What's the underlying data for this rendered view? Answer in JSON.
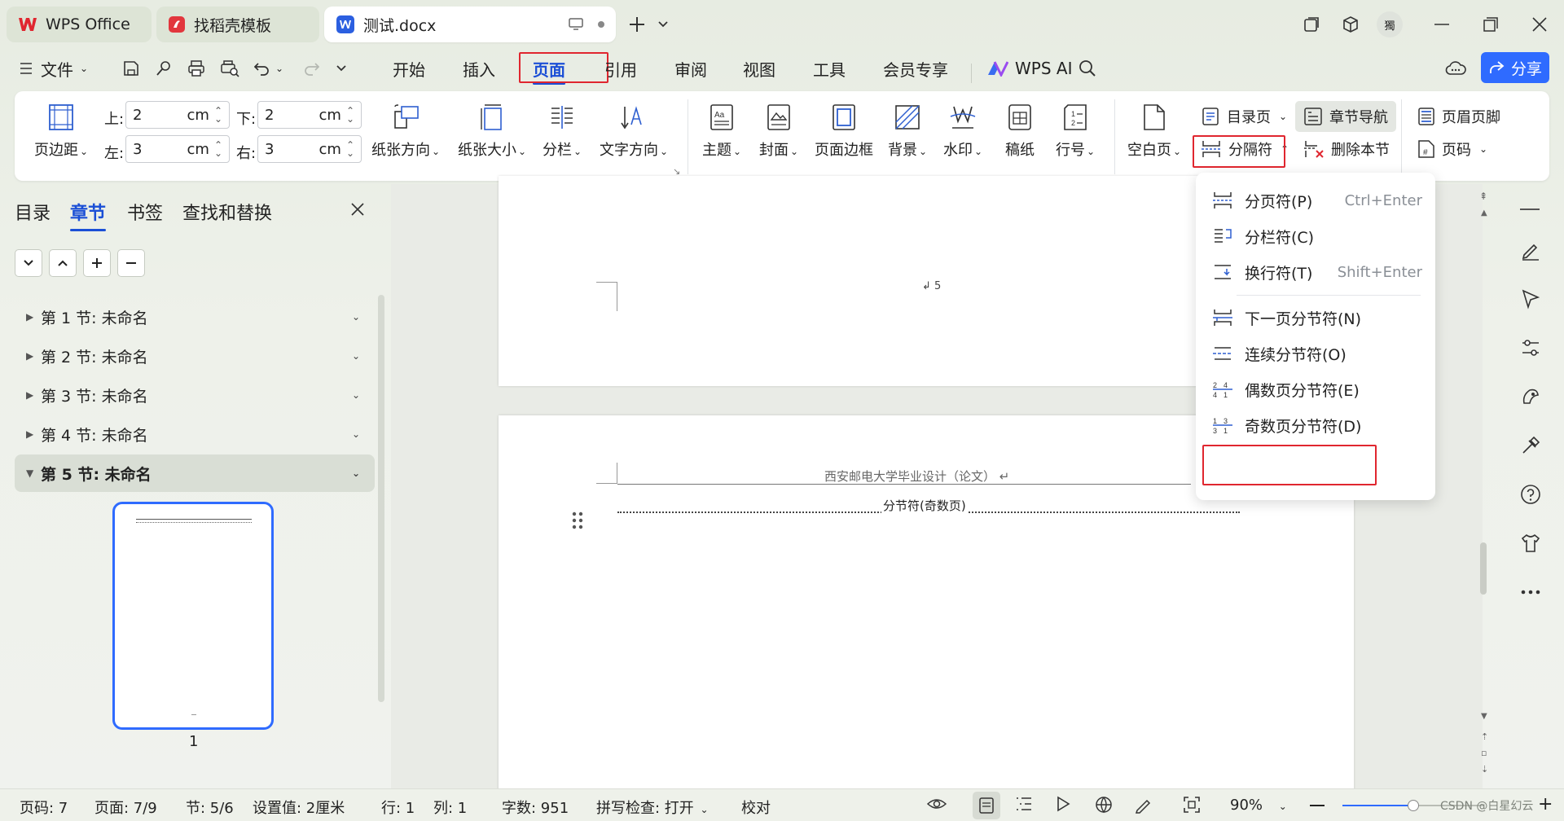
{
  "colors": {
    "accent": "#1b4fd6",
    "highlight_red": "#e0262f",
    "wps_red": "#e0262f",
    "share_button": "#2f6bff"
  },
  "tabs": [
    {
      "label": "WPS Office",
      "icon": "wps-logo-icon"
    },
    {
      "label": "找稻壳模板",
      "icon": "docer-icon"
    },
    {
      "label": "测试.docx",
      "icon": "word-doc-icon"
    }
  ],
  "user_avatar_text": "獨",
  "menu": {
    "file": "文件",
    "items": [
      "开始",
      "插入",
      "页面",
      "引用",
      "审阅",
      "视图",
      "工具",
      "会员专享"
    ],
    "active": "页面",
    "wps_ai": "WPS AI",
    "share": "分享"
  },
  "ribbon": {
    "margins": "页边距",
    "top_label": "上:",
    "top_value": "2",
    "bottom_label": "下:",
    "bottom_value": "2",
    "left_label": "左:",
    "left_value": "3",
    "right_label": "右:",
    "right_value": "3",
    "unit": "cm",
    "orientation": "纸张方向",
    "size": "纸张大小",
    "columns": "分栏",
    "text_direction": "文字方向",
    "theme": "主题",
    "cover": "封面",
    "page_border": "页面边框",
    "background": "背景",
    "watermark": "水印",
    "manuscript": "稿纸",
    "line_number": "行号",
    "blank_page": "空白页",
    "toc_page": "目录页",
    "breaks": "分隔符",
    "section_nav": "章节导航",
    "delete_section": "删除本节",
    "header_footer": "页眉页脚",
    "page_number": "页码"
  },
  "left_panel": {
    "tabs": [
      "目录",
      "章节",
      "书签",
      "查找和替换"
    ],
    "active_tab": "章节",
    "sections": [
      "第 1 节: 未命名",
      "第 2 节: 未命名",
      "第 3 节: 未命名",
      "第 4 节: 未命名",
      "第 5 节: 未命名"
    ],
    "selected_section": 4,
    "thumbnail_page": "1"
  },
  "document": {
    "page_number_mark": "5",
    "header_text": "西安邮电大学毕业设计（论文）",
    "section_break": "分节符(奇数页)"
  },
  "dropdown": {
    "items": [
      {
        "label": "分页符(P)",
        "shortcut": "Ctrl+Enter",
        "icon": "page-break-icon"
      },
      {
        "label": "分栏符(C)",
        "shortcut": "",
        "icon": "column-break-icon"
      },
      {
        "label": "换行符(T)",
        "shortcut": "Shift+Enter",
        "icon": "line-break-icon"
      },
      {
        "label": "下一页分节符(N)",
        "shortcut": "",
        "icon": "next-page-section-icon"
      },
      {
        "label": "连续分节符(O)",
        "shortcut": "",
        "icon": "continuous-section-icon"
      },
      {
        "label": "偶数页分节符(E)",
        "shortcut": "",
        "icon": "even-page-section-icon"
      },
      {
        "label": "奇数页分节符(D)",
        "shortcut": "",
        "icon": "odd-page-section-icon"
      }
    ],
    "highlighted": 6
  },
  "status": {
    "page_no": "页码: 7",
    "pages": "页面: 7/9",
    "section": "节: 5/6",
    "setting": "设置值: 2厘米",
    "row": "行: 1",
    "col": "列: 1",
    "words": "字数: 951",
    "spell": "拼写检查: 打开",
    "proof": "校对",
    "zoom": "90%",
    "zoom_fraction": 0.5,
    "watermark": "CSDN @白星幻云"
  }
}
